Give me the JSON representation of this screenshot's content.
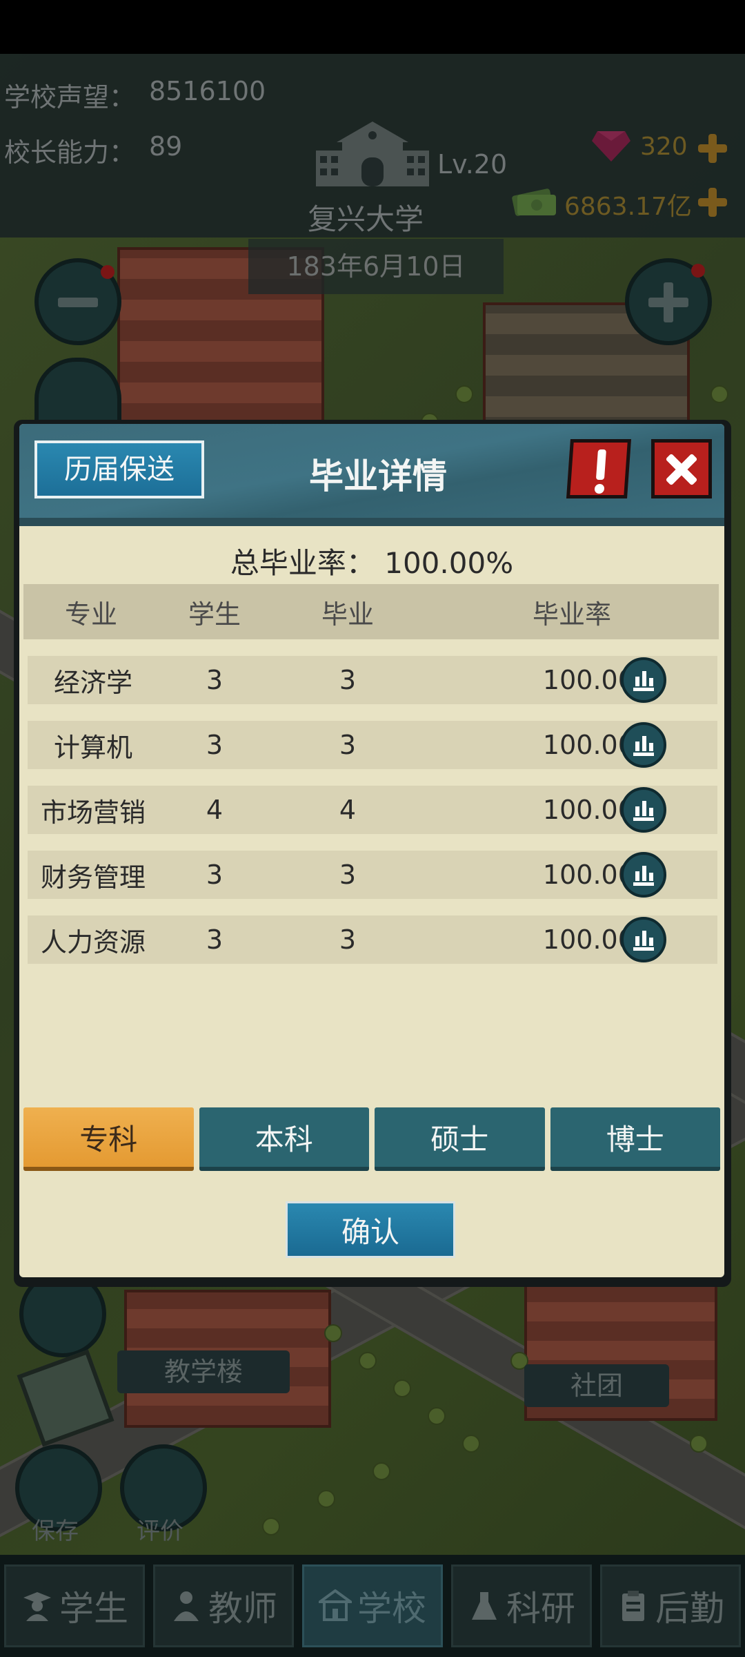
{
  "hud": {
    "prestige_label": "学校声望：",
    "prestige_value": "8516100",
    "ability_label": "校长能力：",
    "ability_value": "89",
    "level": "Lv.20",
    "school_name": "复兴大学",
    "gems": "320",
    "money": "6863.17亿",
    "date": "183年6月10日"
  },
  "map_labels": {
    "teaching_building": "教学楼",
    "club": "社团"
  },
  "side_buttons": {
    "save": "保存",
    "review": "评价"
  },
  "dialog": {
    "history_button": "历届保送",
    "title": "毕业详情",
    "total_rate": "总毕业率：  100.00%",
    "columns": [
      "专业",
      "学生",
      "毕业",
      "毕业率"
    ],
    "rows": [
      {
        "major": "经济学",
        "students": "3",
        "graduates": "3",
        "rate": "100.00%"
      },
      {
        "major": "计算机",
        "students": "3",
        "graduates": "3",
        "rate": "100.00%"
      },
      {
        "major": "市场营销",
        "students": "4",
        "graduates": "4",
        "rate": "100.00%"
      },
      {
        "major": "财务管理",
        "students": "3",
        "graduates": "3",
        "rate": "100.00%"
      },
      {
        "major": "人力资源",
        "students": "3",
        "graduates": "3",
        "rate": "100.00%"
      }
    ],
    "tabs": [
      "专科",
      "本科",
      "硕士",
      "博士"
    ],
    "active_tab": "专科",
    "confirm_button": "确认"
  },
  "bottom_nav": [
    "学生",
    "教师",
    "学校",
    "科研",
    "后勤"
  ],
  "bottom_nav_active": "学校",
  "colors": {
    "accent_orange": "#e49a32",
    "tab_teal": "#2b6570",
    "close_red": "#b8201d",
    "panel_cream": "#e8e3c4"
  }
}
